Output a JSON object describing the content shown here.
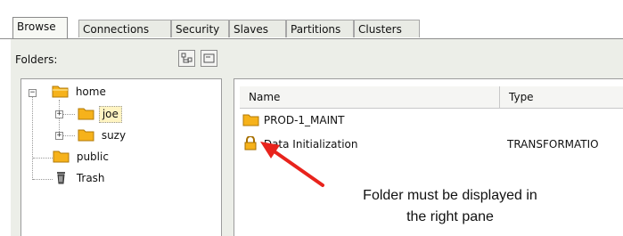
{
  "tabs": [
    "Browse",
    "Connections",
    "Security",
    "Slaves",
    "Partitions",
    "Clusters"
  ],
  "active_tab": "Browse",
  "folders_label": "Folders:",
  "tree": {
    "home": "home",
    "joe": "joe",
    "suzy": "suzy",
    "public": "public",
    "trash": "Trash"
  },
  "list": {
    "columns": [
      "Name",
      "Type"
    ],
    "rows": [
      {
        "name": "PROD-1_MAINT",
        "type": ""
      },
      {
        "name": "Data Initialization",
        "type": "TRANSFORMATIO"
      }
    ]
  },
  "annotation": {
    "line1": "Folder must be displayed in",
    "line2": "the right pane"
  },
  "colors": {
    "folder": "#f6b21b",
    "arrow": "#e8231c"
  }
}
